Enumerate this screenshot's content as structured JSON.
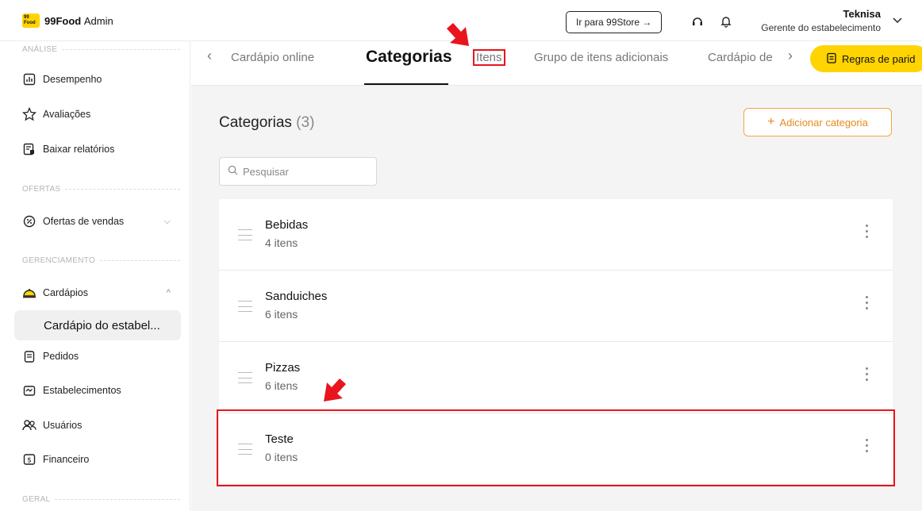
{
  "app": {
    "brand": "99Food",
    "brand_suffix": "Admin",
    "logo_badge": "99 Food"
  },
  "topbar": {
    "store_button": "Ir para 99Store →",
    "user_name": "Teknisa",
    "user_role": "Gerente do estabelecimento"
  },
  "sidebar": {
    "sections": {
      "analise": "ANÁLISE",
      "ofertas": "OFERTAS",
      "gerenciamento": "GERENCIAMENTO",
      "geral": "GERAL"
    },
    "items": [
      {
        "label": "Desempenho",
        "icon": "chart-icon"
      },
      {
        "label": "Avaliações",
        "icon": "star-icon"
      },
      {
        "label": "Baixar relatórios",
        "icon": "report-icon"
      },
      {
        "label": "Ofertas de vendas",
        "icon": "percent-icon"
      },
      {
        "label": "Cardápios",
        "icon": "cloche-icon"
      },
      {
        "label": "Cardápio do estabel...",
        "icon": ""
      },
      {
        "label": "Pedidos",
        "icon": "clipboard-icon"
      },
      {
        "label": "Estabelecimentos",
        "icon": "store-icon"
      },
      {
        "label": "Usuários",
        "icon": "users-icon"
      },
      {
        "label": "Financeiro",
        "icon": "money-icon"
      }
    ]
  },
  "tabs": {
    "items": [
      "Cardápio online",
      "Categorias",
      "Itens",
      "Grupo de itens adicionais",
      "Cardápio de"
    ],
    "rules_button": "Regras de parid"
  },
  "main": {
    "title": "Categorias",
    "count": "(3)",
    "add_button": "Adicionar categoria",
    "search_placeholder": "Pesquisar",
    "categories": [
      {
        "name": "Bebidas",
        "items": "4 itens"
      },
      {
        "name": "Sanduiches",
        "items": "6 itens"
      },
      {
        "name": "Pizzas",
        "items": "6 itens"
      },
      {
        "name": "Teste",
        "items": "0 itens"
      }
    ]
  },
  "colors": {
    "accent": "#ffd400",
    "orange": "#e88a1a",
    "highlight": "#e8141e"
  }
}
